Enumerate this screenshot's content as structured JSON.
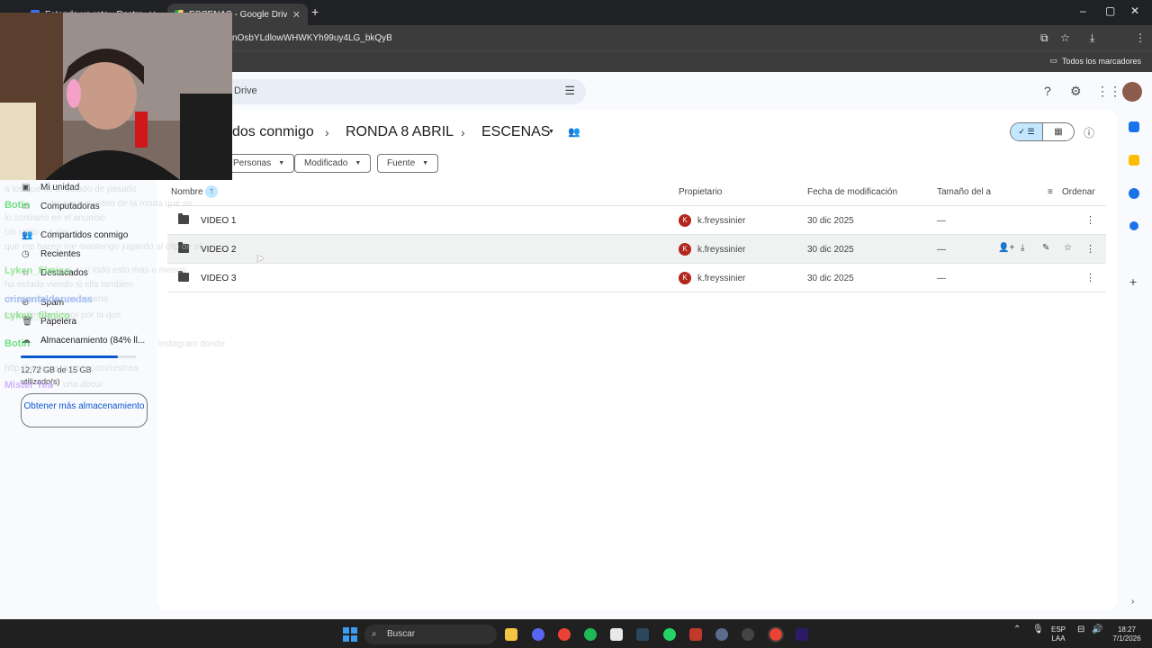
{
  "browser": {
    "tabs": [
      {
        "title": "Estando un rato - Restream",
        "active": false
      },
      {
        "title": "ESCENAS - Google Drive",
        "active": true
      }
    ],
    "new_tab": "+",
    "url": "nOsbYLdlowWHWKYh99uy4LG_bkQyB",
    "bookmarks_label": "Todos los marcadores",
    "window_controls": {
      "minimize": "–",
      "maximize": "▢",
      "close": "✕"
    }
  },
  "drive": {
    "search_placeholder": "Drive",
    "breadcrumb": [
      "dos conmigo",
      "RONDA 8 ABRIL",
      "ESCENAS"
    ],
    "breadcrumb_sep": "›",
    "filters": [
      "Personas",
      "Modificado",
      "Fuente"
    ],
    "columns": {
      "name": "Nombre",
      "owner": "Propietario",
      "modified": "Fecha de modificación",
      "size": "Tamaño del a",
      "sort": "Ordenar"
    },
    "files": [
      {
        "name": "VIDEO 1",
        "owner_initial": "K",
        "owner": "k.freyssinier",
        "date": "30 dic 2025",
        "size": "—"
      },
      {
        "name": "VIDEO 2",
        "owner_initial": "K",
        "owner": "k.freyssinier",
        "date": "30 dic 2025",
        "size": "—"
      },
      {
        "name": "VIDEO 3",
        "owner_initial": "K",
        "owner": "k.freyssinier",
        "date": "30 dic 2025",
        "size": "—"
      }
    ]
  },
  "sidebar": {
    "items": [
      {
        "label": "Mi unidad",
        "icon": "drive-icon"
      },
      {
        "label": "Computadoras",
        "icon": "computer-icon"
      },
      {
        "label": "Compartidos conmigo",
        "icon": "people-icon"
      },
      {
        "label": "Recientes",
        "icon": "clock-icon"
      },
      {
        "label": "Destacados",
        "icon": "star-icon"
      },
      {
        "label": "Spam",
        "icon": "spam-icon"
      },
      {
        "label": "Papelera",
        "icon": "trash-icon"
      },
      {
        "label": "Almacenamiento (84% ll...",
        "icon": "cloud-icon"
      }
    ],
    "storage_fraction": 0.84,
    "storage_text": "12,72 GB de 15 GB utilizado(s)",
    "get_more": "Obtener más almacenamiento"
  },
  "chat": [
    {
      "user": "Botin",
      "color": "#4cd964"
    },
    {
      "user": "Lyken_filmico",
      "color": "#7ee27e"
    },
    {
      "user": "crimentalderuedas",
      "color": "#8fb4ff"
    },
    {
      "user": "Lyken_filmico",
      "color": "#7ee27e"
    },
    {
      "user": "Botin",
      "color": "#4cd964"
    },
    {
      "user": "Mister Tea",
      "color": "#c9a0ff"
    }
  ],
  "chat_fragments": [
    "a los que es el estado de pasado",
    "sitio para el video de la ronda que se",
    "lo contrario en el anuncio",
    "Un ratito y a dar",
    "que me hacen me mantengo jugando al clip de el",
    "y todo esto mas o menos",
    "ha estado viendo si ella tambien",
    "un poquito de una escena",
    "en la tienda mayor por la que",
    "Instagram donde",
    "http://www.instagram.com/restrea",
    "una decor"
  ],
  "taskbar": {
    "search": "Buscar",
    "lang": "ESP",
    "region": "LAA",
    "time": "18:27",
    "date": "7/1/2026"
  }
}
